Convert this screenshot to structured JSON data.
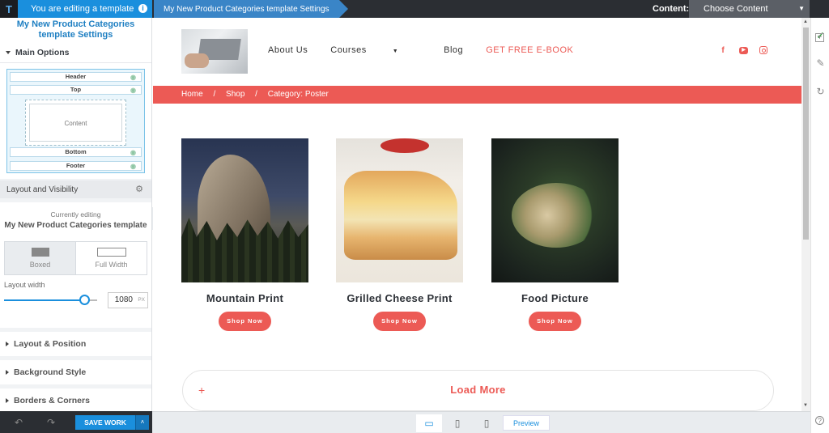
{
  "topbar": {
    "editing_label": "You are editing a template",
    "settings_tab": "My New Product Categories template Settings",
    "content_label": "Content:",
    "content_select": "Choose Content"
  },
  "left_panel": {
    "title_line1": "My New Product Categories",
    "title_line2": "template Settings",
    "main_options": "Main Options",
    "layout_rows": {
      "header": "Header",
      "top": "Top",
      "content": "Content",
      "bottom": "Bottom",
      "footer": "Footer"
    },
    "layout_visibility": "Layout and Visibility",
    "currently_editing": "Currently editing",
    "template_name": "My New Product Categories template",
    "width_options": [
      "Boxed",
      "Full Width"
    ],
    "width_selected": "Boxed",
    "layout_width_label": "Layout width",
    "layout_width_value": "1080",
    "layout_width_unit": "PX",
    "layout_width_fraction": 0.82,
    "sections": [
      "Layout & Position",
      "Background Style",
      "Borders & Corners"
    ],
    "save_label": "SAVE WORK"
  },
  "site": {
    "nav": {
      "about": "About Us",
      "courses": "Courses",
      "blog": "Blog",
      "ebook": "GET FREE E-BOOK"
    },
    "breadcrumb": [
      "Home",
      "Shop",
      "Category: Poster"
    ],
    "breadcrumb_sep": "/",
    "products": [
      {
        "name": "Mountain Print",
        "button": "Shop Now"
      },
      {
        "name": "Grilled Cheese Print",
        "button": "Shop Now"
      },
      {
        "name": "Food Picture",
        "button": "Shop Now"
      }
    ],
    "load_more": "Load More",
    "load_more_icon": "+"
  },
  "device_bar": {
    "preview": "Preview",
    "devices": [
      "desktop-icon",
      "tablet-icon",
      "mobile-icon"
    ],
    "active": "desktop-icon"
  },
  "colors": {
    "accent": "#ec5a55",
    "editor_blue": "#1a8fdd",
    "dark_bar": "#2b2e33"
  }
}
